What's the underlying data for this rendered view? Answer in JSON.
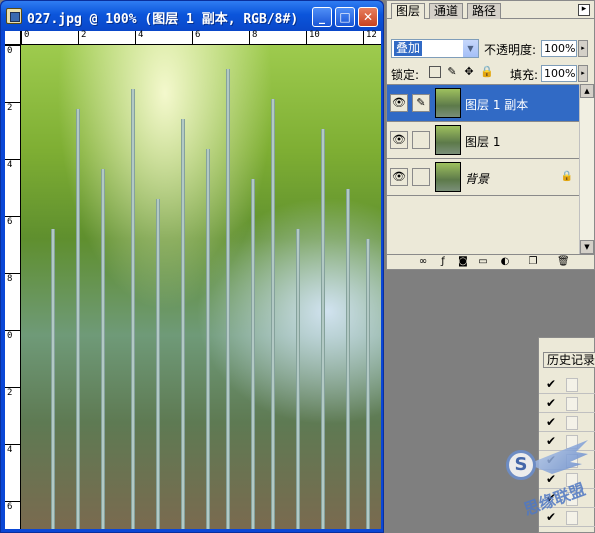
{
  "document": {
    "title": "027.jpg @ 100% (图层 1 副本, RGB/8#)",
    "buttons": {
      "minimize": "_",
      "maximize": "□",
      "close": "✕"
    },
    "ruler_top_labels": [
      "0",
      "2",
      "4",
      "6",
      "8",
      "10",
      "12"
    ],
    "ruler_left_labels": [
      "0",
      "2",
      "4",
      "6",
      "8",
      "0",
      "2",
      "4",
      "6"
    ]
  },
  "layers_panel": {
    "tabs": [
      "图层",
      "通道",
      "路径"
    ],
    "active_tab": "图层",
    "blend_mode": "叠加",
    "opacity_label": "不透明度:",
    "opacity_value": "100%",
    "lock_label": "锁定:",
    "fill_label": "填充:",
    "fill_value": "100%",
    "layers": [
      {
        "name": "图层 1 副本",
        "selected": true
      },
      {
        "name": "图层 1",
        "selected": false
      },
      {
        "name": "背景",
        "selected": false,
        "locked": true
      }
    ]
  },
  "history_panel": {
    "tab": "历史记录"
  },
  "watermark": {
    "text": "思缘联盟"
  },
  "colors": {
    "title_blue": "#0b55db",
    "selection_blue": "#316ac5",
    "panel_bg": "#ece9d8"
  }
}
